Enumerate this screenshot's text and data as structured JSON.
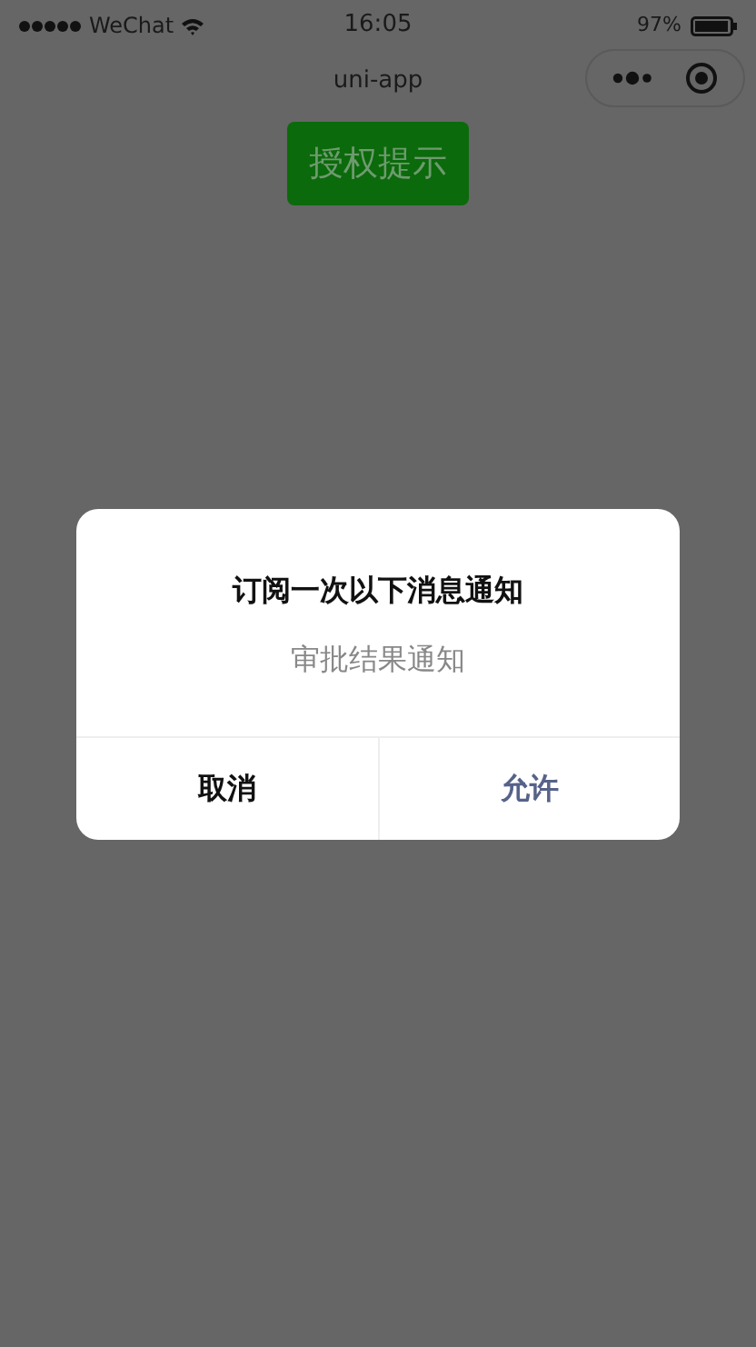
{
  "status_bar": {
    "carrier": "WeChat",
    "time": "16:05",
    "battery": "97%"
  },
  "nav_bar": {
    "title": "uni-app"
  },
  "auth_button": {
    "label": "授权提示"
  },
  "dialog": {
    "title": "订阅一次以下消息通知",
    "message": "审批结果通知",
    "buttons": [
      {
        "label": "取消",
        "kind": "cancel"
      },
      {
        "label": "允许",
        "kind": "confirm"
      }
    ]
  }
}
